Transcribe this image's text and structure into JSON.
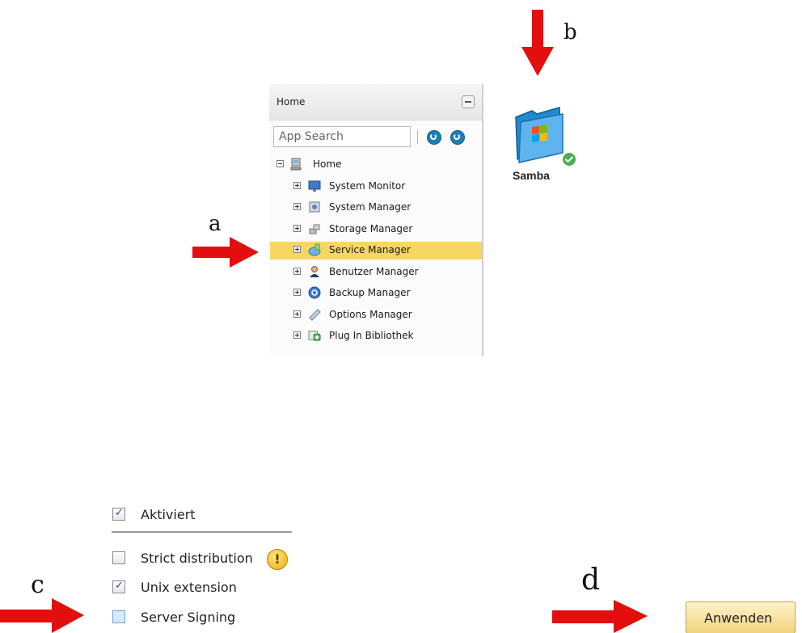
{
  "annotations": {
    "a": "a",
    "b": "b",
    "c": "c",
    "d": "d"
  },
  "panel": {
    "title": "Home",
    "search_placeholder": "App Search",
    "tree": {
      "root": "Home",
      "items": [
        {
          "label": "System Monitor"
        },
        {
          "label": "System Manager"
        },
        {
          "label": "Storage Manager"
        },
        {
          "label": "Service Manager",
          "selected": true
        },
        {
          "label": "Benutzer Manager"
        },
        {
          "label": "Backup Manager"
        },
        {
          "label": "Options Manager"
        },
        {
          "label": "Plug In Bibliothek"
        }
      ]
    }
  },
  "app": {
    "label": "Samba",
    "status": "active"
  },
  "options": {
    "aktiviert": {
      "label": "Aktiviert",
      "checked": true
    },
    "strict_distribution": {
      "label": "Strict distribution",
      "checked": false
    },
    "unix_extension": {
      "label": "Unix extension",
      "checked": true
    },
    "server_signing": {
      "label": "Server Signing",
      "checked": false
    }
  },
  "apply_button": "Anwenden",
  "colors": {
    "arrow": "#e30f0f",
    "selection": "#f8d663",
    "apply_button": "#f2d37d"
  }
}
